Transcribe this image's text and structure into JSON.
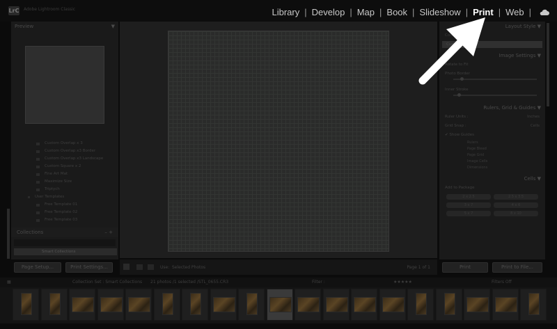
{
  "app": {
    "title": "Adobe Lightroom Classic",
    "logo": "LrC"
  },
  "modules": [
    {
      "label": "Library",
      "active": false
    },
    {
      "label": "Develop",
      "active": false
    },
    {
      "label": "Map",
      "active": false
    },
    {
      "label": "Book",
      "active": false
    },
    {
      "label": "Slideshow",
      "active": false
    },
    {
      "label": "Print",
      "active": true
    },
    {
      "label": "Web",
      "active": false
    }
  ],
  "module_separator": "|",
  "cloud_icon": "cloud-icon",
  "left_panel": {
    "preview_title": "Preview",
    "templates": [
      {
        "label": "Custom Overlap x 3",
        "type": "item"
      },
      {
        "label": "Custom Overlap x3 Border",
        "type": "item"
      },
      {
        "label": "Custom Overlap x3 Landscape",
        "type": "item"
      },
      {
        "label": "Custom Square x 2",
        "type": "item"
      },
      {
        "label": "Fine Art Mat",
        "type": "item"
      },
      {
        "label": "Maximize Size",
        "type": "item"
      },
      {
        "label": "Triptych",
        "type": "item"
      },
      {
        "label": "User Templates",
        "type": "folder"
      },
      {
        "label": "Free Template 01",
        "type": "item"
      },
      {
        "label": "Free Template 02",
        "type": "item"
      },
      {
        "label": "Free Template 03",
        "type": "item"
      }
    ],
    "collections_title": "Collections",
    "collections_controls": "–  +",
    "smart_collections": "Smart Collections",
    "page_setup": "Page Setup...",
    "print_settings": "Print Settings..."
  },
  "toolbar": {
    "use_label": "Use:",
    "use_value": "Selected Photos",
    "page_info": "Page 1 of 1"
  },
  "right_panel": {
    "layout_style": "Layout Style",
    "layout_option": "Custom Package",
    "contact_sheet": "Contact Sheet",
    "image_settings": "Image Settings",
    "rotate_to_fit": "Rotate to Fit",
    "photo_border": "Photo Border",
    "inner_stroke": "Inner Stroke",
    "width_label": "Width",
    "rulers_title": "Rulers, Grid & Guides",
    "ruler_units": "Ruler Units :",
    "ruler_units_value": "Inches",
    "grid_snap": "Grid Snap :",
    "grid_snap_value": "Cells",
    "show_guides": "Show Guides",
    "guides": [
      "Rulers",
      "Page Bleed",
      "Page Grid",
      "Image Cells",
      "Dimensions"
    ],
    "cells_title": "Cells",
    "add_to_package": "Add to Package",
    "cell_sizes": [
      "2 x 2.5",
      "2.5 x 3.5",
      "3 x 7",
      "4 x 6",
      "5 x 7",
      "8 x 10"
    ],
    "print_button": "Print",
    "printer_button": "Print to File..."
  },
  "filmbar": {
    "source": "Collection Set : Smart Collections",
    "count": "21 photos /1 selected /STL_0655.CR3",
    "filter_label": "Filter :",
    "filter_value": "Filters Off"
  },
  "thumbnails": [
    {
      "orient": "portrait"
    },
    {
      "orient": "portrait"
    },
    {
      "orient": "landscape"
    },
    {
      "orient": "landscape"
    },
    {
      "orient": "landscape"
    },
    {
      "orient": "portrait"
    },
    {
      "orient": "portrait"
    },
    {
      "orient": "landscape"
    },
    {
      "orient": "portrait"
    },
    {
      "orient": "landscape",
      "selected": true
    },
    {
      "orient": "landscape"
    },
    {
      "orient": "landscape"
    },
    {
      "orient": "landscape"
    },
    {
      "orient": "landscape"
    },
    {
      "orient": "portrait"
    },
    {
      "orient": "portrait"
    },
    {
      "orient": "landscape"
    },
    {
      "orient": "landscape"
    },
    {
      "orient": "portrait"
    }
  ],
  "colors": {
    "accent_arrow": "#ffffff",
    "active_module": "#ffffff",
    "module_text": "#c8c8c8"
  }
}
